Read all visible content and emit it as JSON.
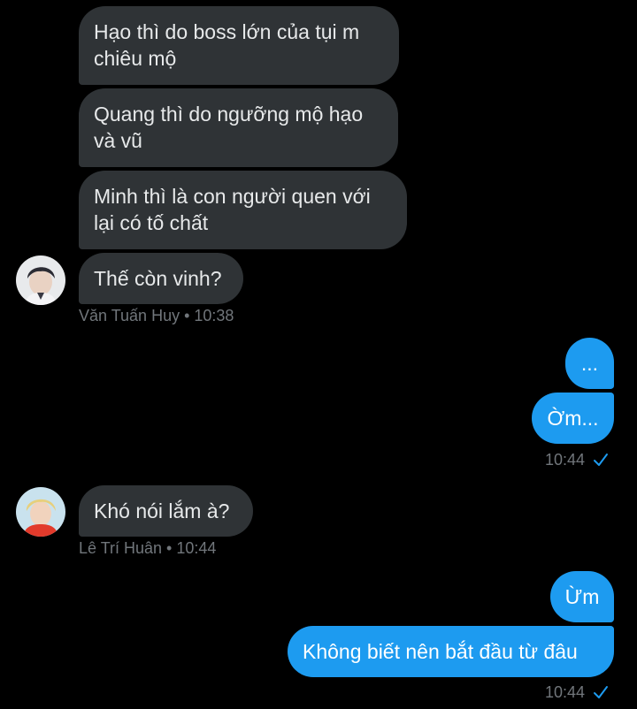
{
  "colors": {
    "background": "#000000",
    "incoming_bubble": "#2f3336",
    "outgoing_bubble": "#1d9bf0",
    "meta_text": "#71767b",
    "read_check": "#1d9bf0"
  },
  "messages": {
    "m1": "Hạo thì do boss lớn của tụi m\nchiêu mộ",
    "m2": "Quang thì do ngưỡng mộ hạo\nvà vũ",
    "m3": "Minh thì là con người quen với\nlại có tố chất",
    "m4": "Thế còn vinh?",
    "m5": "...",
    "m6": "Ờm...",
    "m7": "Khó nói lắm à?",
    "m8": "Ừm",
    "m9": "Không biết nên bắt đầu từ đâu"
  },
  "meta": {
    "sender1": "Văn Tuấn Huy • 10:38",
    "out_time1": "10:44",
    "sender2": "Lê Trí Huân • 10:44",
    "out_time2": "10:44"
  },
  "icons": {
    "avatar1": "avatar-van-tuan-huy",
    "avatar2": "avatar-le-tri-huan",
    "read": "read-check-icon"
  }
}
